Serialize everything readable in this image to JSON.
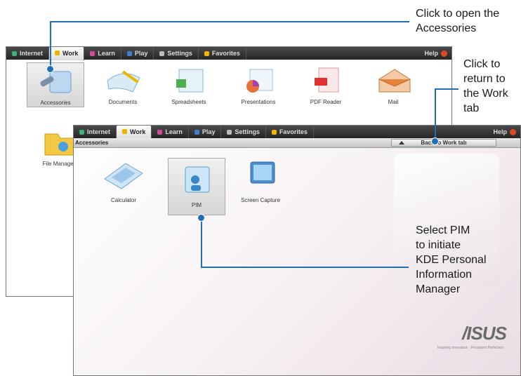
{
  "callouts": {
    "accessories": [
      "Click to open the",
      "Accessories"
    ],
    "back": [
      "Click to",
      "return to",
      "the Work",
      "tab"
    ],
    "pim": [
      "Select PIM",
      "to initiate",
      "KDE Personal",
      "Information",
      "Manager"
    ]
  },
  "tabs": [
    {
      "label": "Internet",
      "icon": "globe-icon",
      "color": "#3cb371"
    },
    {
      "label": "Work",
      "icon": "work-icon",
      "color": "#f0b400"
    },
    {
      "label": "Learn",
      "icon": "learn-icon",
      "color": "#d04ca0"
    },
    {
      "label": "Play",
      "icon": "play-icon",
      "color": "#3f7fd0"
    },
    {
      "label": "Settings",
      "icon": "settings-icon",
      "color": "#bbbbbb"
    },
    {
      "label": "Favorites",
      "icon": "star-icon",
      "color": "#f0b400"
    }
  ],
  "help_label": "Help",
  "back_window": {
    "apps": [
      "Accessories",
      "Documents",
      "Spreadsheets",
      "Presentations",
      "PDF Reader",
      "Mail"
    ],
    "apps_row2": [
      "File Manager"
    ]
  },
  "front_window": {
    "breadcrumb": "Accessories",
    "back_button": "Back to Work tab",
    "apps": [
      "Calculator",
      "PIM",
      "Screen Capture"
    ]
  },
  "brand": {
    "logo": "/ISUS",
    "tagline": "Inspiring Innovation · Persistent Perfection"
  },
  "colors": {
    "accent": "#1f6fb5",
    "tabbar": "#2e2e2e"
  }
}
